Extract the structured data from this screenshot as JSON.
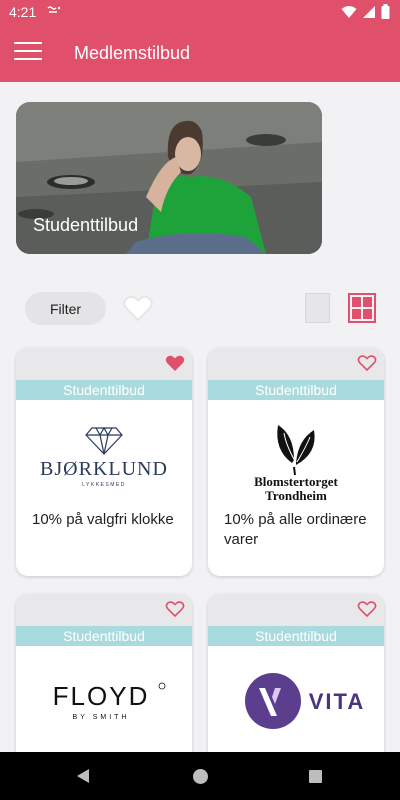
{
  "status_bar": {
    "time": "4:21",
    "carrier_icon": "sim-icon",
    "icons": [
      "wifi-icon",
      "signal-icon",
      "battery-icon"
    ]
  },
  "app_bar": {
    "title": "Medlemstilbud",
    "menu_icon": "hamburger-menu-icon"
  },
  "hero": {
    "label": "Studenttilbud"
  },
  "toolbar": {
    "filter_label": "Filter",
    "favorites_icon": "heart-outline-icon",
    "view_modes": [
      "list-view-icon",
      "grid-view-icon"
    ],
    "selected_view": "grid"
  },
  "colors": {
    "accent": "#e1506a",
    "tag": "#a9dbde",
    "card_top": "#e8e8ea",
    "background": "#f2f2f4",
    "vita_purple": "#5b3e8e"
  },
  "offers": [
    {
      "tag": "Studenttilbud",
      "brand": "BJØRKLUND",
      "brand_sub": "LYKKESMED",
      "description": "10% på valgfri klokke",
      "favorite": true
    },
    {
      "tag": "Studenttilbud",
      "brand": "Blomstertorget",
      "brand_sub": "Trondheim",
      "description": "10% på alle ordinære varer",
      "favorite": false
    },
    {
      "tag": "Studenttilbud",
      "brand": "FLOYD",
      "brand_sub": "BY SMITH",
      "description": "",
      "favorite": false
    },
    {
      "tag": "Studenttilbud",
      "brand": "VITA",
      "brand_sub": "",
      "description": "",
      "favorite": false
    }
  ],
  "nav_bar": {
    "icons": [
      "back-icon",
      "home-icon",
      "recent-apps-icon"
    ]
  }
}
